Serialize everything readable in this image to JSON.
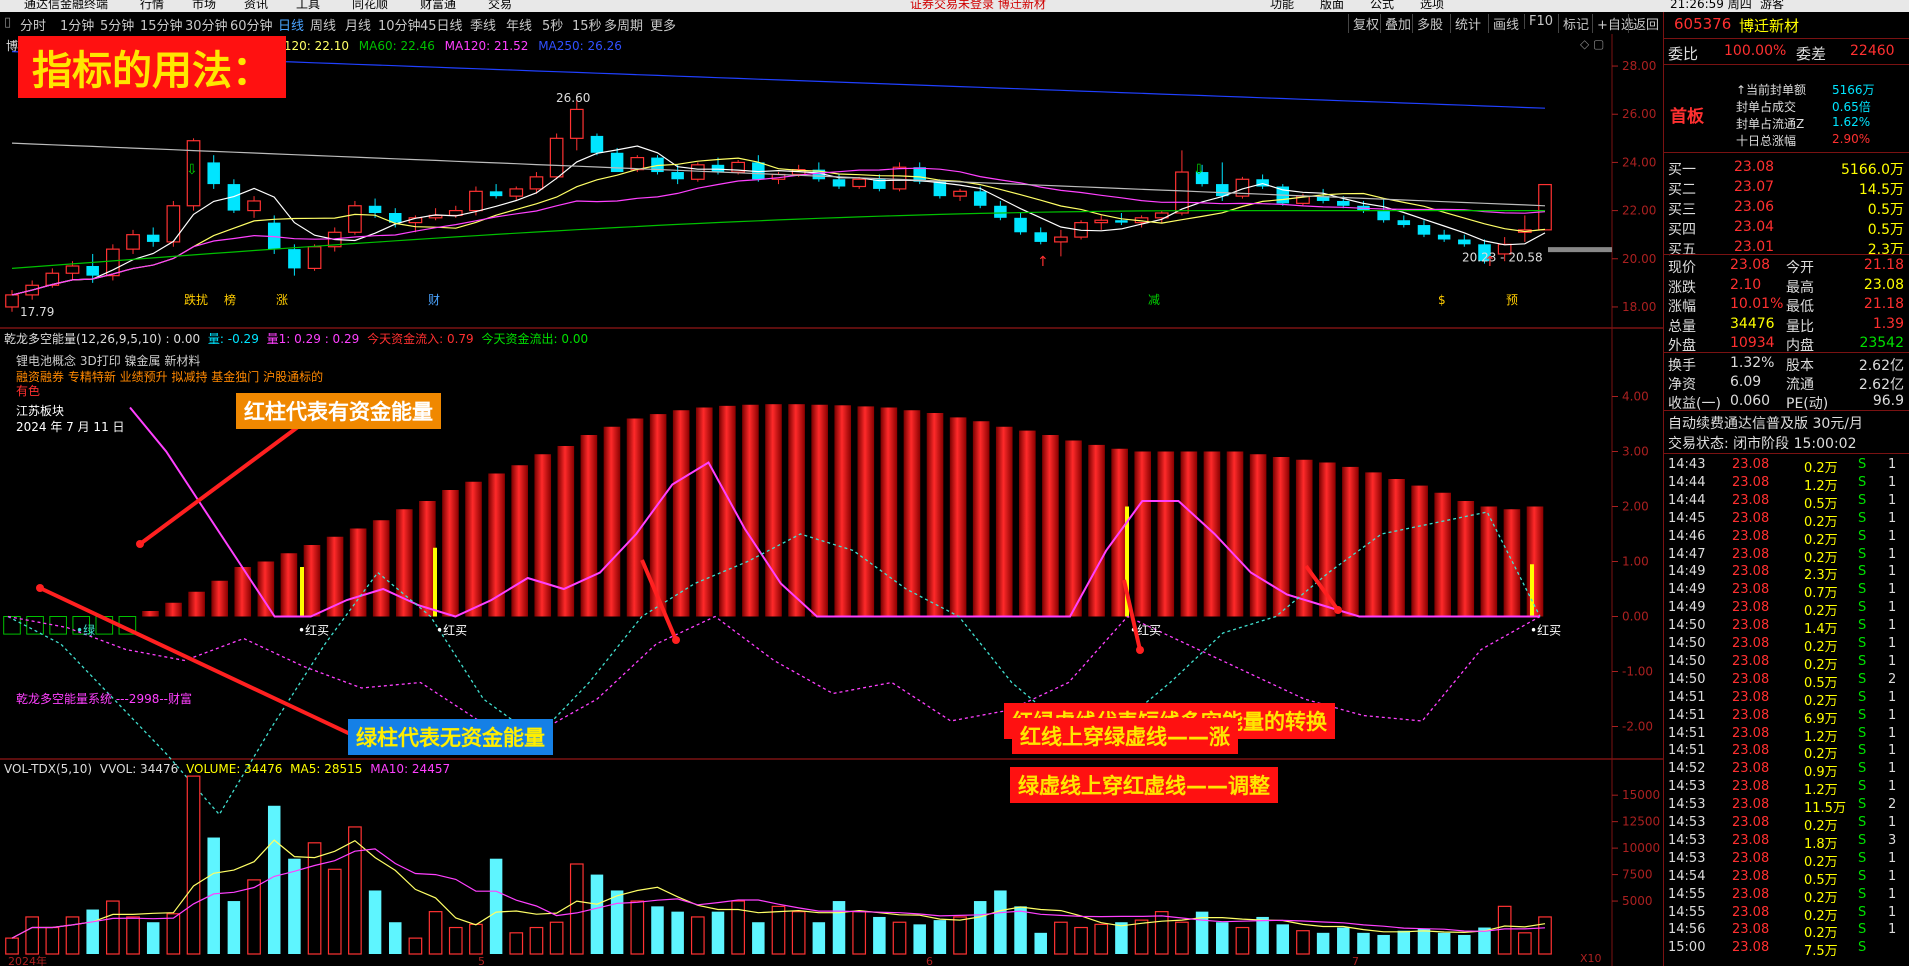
{
  "top_menu": {
    "items": [
      "通达信金融终端",
      "行情",
      "市场",
      "资讯",
      "工具",
      "发现",
      "同花顺",
      "财富通",
      "交易"
    ],
    "notice": "证券交易未登录  博迁新材",
    "right_items": [
      "功能",
      "版面",
      "公式",
      "选项"
    ],
    "clock": "21:26:59 周四",
    "right_label": "游客"
  },
  "period_tabs": [
    "分时",
    "1分钟",
    "5分钟",
    "15分钟",
    "30分钟",
    "60分钟",
    "日线",
    "周线",
    "月线",
    "10分钟",
    "45日线",
    "季线",
    "年线",
    "5秒",
    "15秒",
    "多周期",
    "更多"
  ],
  "active_period": "日线",
  "toolbar": [
    "复权",
    "叠加",
    "多股",
    "统计",
    "画线",
    "F10",
    "标记",
    "+自选",
    "返回"
  ],
  "main_chart": {
    "legend": {
      "name": "博迁",
      "ma20": "120: 22.10",
      "ma60": "MA60: 22.46",
      "ma120": "MA120: 21.52",
      "ma250": "MA250: 26.26"
    },
    "y_ticks": [
      "28.00",
      "26.00",
      "24.00",
      "22.00",
      "20.00",
      "18.00"
    ],
    "high_label": "26.60",
    "low_label": "17.79",
    "range_label": "20.23 - 20.58",
    "event_tags": [
      "跌扰",
      "榜",
      "涨",
      "财",
      "减",
      "$",
      "预"
    ],
    "colors": {
      "up": "#ff3232",
      "down": "#00e5ff",
      "ma_white": "#ffffff",
      "ma_yellow": "#ffff66",
      "ma_pink": "#ff40ff",
      "ma_green": "#00c000",
      "ma_blue": "#2040ff"
    }
  },
  "indicator": {
    "title": "乾龙多空能量(12,26,9,5,10) : 0.00",
    "liang": "量: -0.29",
    "liang1": "量1: 0.29 : 0.29",
    "inflow": "今天资金流入: 0.79",
    "outflow": "今天资金流出: 0.00",
    "info_lines": [
      "锂电池概念 3D打印 镍金属 新材料",
      "融资融券 专精特新 业绩预升 拟减持 基金独门 沪股通标的",
      "有色",
      "江苏板块"
    ],
    "date": "2024 年 7 月 11 日",
    "y_ticks": [
      "4.00",
      "3.00",
      "2.00",
      "1.00",
      "0.00",
      "-1.00",
      "-2.00"
    ],
    "signals": [
      "绿",
      "红买",
      "红买",
      "红买",
      "红买"
    ],
    "system_label": "乾龙多空能量系统 ---2998--财富"
  },
  "volume": {
    "title": "VOL-TDX(5,10)",
    "vvol": "VVOL: 34476",
    "volume": "VOLUME: 34476",
    "ma5": "MA5: 28515",
    "ma10": "MA10: 24457",
    "y_ticks": [
      "15000",
      "12500",
      "10000",
      "7500",
      "5000"
    ],
    "unit": "X10",
    "x_labels": [
      "2024年",
      "5",
      "6",
      "7"
    ]
  },
  "annotations": {
    "title": "指标的用法：",
    "red_bar": "红柱代表有资金能量",
    "green_bar": "绿柱代表无资金能量",
    "dashed": "红绿虚线代表短线多空能量的转换",
    "rise": "红线上穿绿虚线——涨",
    "adjust": "绿虚线上穿红虚线——调整"
  },
  "quote_panel": {
    "code": "605376",
    "name": "博迁新材",
    "weibi_label": "委比",
    "weibi": "100.00%",
    "weicha_label": "委差",
    "weicha": "22460",
    "board": "首板",
    "seal_info": [
      {
        "label": "↑当前封单额",
        "value": "5166万"
      },
      {
        "label": "封单占成交",
        "value": "0.65倍"
      },
      {
        "label": "封单占流通Z",
        "value": "1.62%"
      },
      {
        "label": "十日总涨幅",
        "value": "2.90%"
      }
    ],
    "bids": [
      {
        "label": "买一",
        "price": "23.08",
        "vol": "5166.0万"
      },
      {
        "label": "买二",
        "price": "23.07",
        "vol": "14.5万"
      },
      {
        "label": "买三",
        "price": "23.06",
        "vol": "0.5万"
      },
      {
        "label": "买四",
        "price": "23.04",
        "vol": "0.5万"
      },
      {
        "label": "买五",
        "price": "23.01",
        "vol": "2.3万"
      }
    ],
    "stats": [
      {
        "l1": "现价",
        "v1": "23.08",
        "l2": "今开",
        "v2": "21.18"
      },
      {
        "l1": "涨跌",
        "v1": "2.10",
        "l2": "最高",
        "v2": "23.08"
      },
      {
        "l1": "涨幅",
        "v1": "10.01%",
        "l2": "最低",
        "v2": "21.18"
      },
      {
        "l1": "总量",
        "v1": "34476",
        "l2": "量比",
        "v2": "1.39"
      },
      {
        "l1": "外盘",
        "v1": "10934",
        "l2": "内盘",
        "v2": "23542"
      }
    ],
    "stats2": [
      {
        "l1": "换手",
        "v1": "1.32%",
        "l2": "股本",
        "v2": "2.62亿"
      },
      {
        "l1": "净资",
        "v1": "6.09",
        "l2": "流通",
        "v2": "2.62亿"
      },
      {
        "l1": "收益(一)",
        "v1": "0.060",
        "l2": "PE(动)",
        "v2": "96.9"
      }
    ],
    "promo": "自动续费通达信普及版  30元/月",
    "status": "交易状态: 闭市阶段 15:00:02",
    "ticks": [
      {
        "t": "14:43",
        "p": "23.08",
        "v": "0.2万",
        "s": "S",
        "n": "1"
      },
      {
        "t": "14:44",
        "p": "23.08",
        "v": "1.2万",
        "s": "S",
        "n": "1"
      },
      {
        "t": "14:44",
        "p": "23.08",
        "v": "0.5万",
        "s": "S",
        "n": "1"
      },
      {
        "t": "14:45",
        "p": "23.08",
        "v": "0.2万",
        "s": "S",
        "n": "1"
      },
      {
        "t": "14:46",
        "p": "23.08",
        "v": "0.2万",
        "s": "S",
        "n": "1"
      },
      {
        "t": "14:47",
        "p": "23.08",
        "v": "0.2万",
        "s": "S",
        "n": "1"
      },
      {
        "t": "14:49",
        "p": "23.08",
        "v": "2.3万",
        "s": "S",
        "n": "1"
      },
      {
        "t": "14:49",
        "p": "23.08",
        "v": "0.7万",
        "s": "S",
        "n": "1"
      },
      {
        "t": "14:49",
        "p": "23.08",
        "v": "0.2万",
        "s": "S",
        "n": "1"
      },
      {
        "t": "14:50",
        "p": "23.08",
        "v": "1.4万",
        "s": "S",
        "n": "1"
      },
      {
        "t": "14:50",
        "p": "23.08",
        "v": "0.2万",
        "s": "S",
        "n": "1"
      },
      {
        "t": "14:50",
        "p": "23.08",
        "v": "0.2万",
        "s": "S",
        "n": "1"
      },
      {
        "t": "14:50",
        "p": "23.08",
        "v": "0.5万",
        "s": "S",
        "n": "2"
      },
      {
        "t": "14:51",
        "p": "23.08",
        "v": "0.2万",
        "s": "S",
        "n": "1"
      },
      {
        "t": "14:51",
        "p": "23.08",
        "v": "6.9万",
        "s": "S",
        "n": "1"
      },
      {
        "t": "14:51",
        "p": "23.08",
        "v": "1.2万",
        "s": "S",
        "n": "1"
      },
      {
        "t": "14:51",
        "p": "23.08",
        "v": "0.2万",
        "s": "S",
        "n": "1"
      },
      {
        "t": "14:52",
        "p": "23.08",
        "v": "0.9万",
        "s": "S",
        "n": "1"
      },
      {
        "t": "14:53",
        "p": "23.08",
        "v": "1.2万",
        "s": "S",
        "n": "1"
      },
      {
        "t": "14:53",
        "p": "23.08",
        "v": "11.5万",
        "s": "S",
        "n": "2"
      },
      {
        "t": "14:53",
        "p": "23.08",
        "v": "0.2万",
        "s": "S",
        "n": "1"
      },
      {
        "t": "14:53",
        "p": "23.08",
        "v": "1.8万",
        "s": "S",
        "n": "3"
      },
      {
        "t": "14:53",
        "p": "23.08",
        "v": "0.2万",
        "s": "S",
        "n": "1"
      },
      {
        "t": "14:54",
        "p": "23.08",
        "v": "0.5万",
        "s": "S",
        "n": "1"
      },
      {
        "t": "14:55",
        "p": "23.08",
        "v": "0.2万",
        "s": "S",
        "n": "1"
      },
      {
        "t": "14:55",
        "p": "23.08",
        "v": "0.2万",
        "s": "S",
        "n": "1"
      },
      {
        "t": "14:56",
        "p": "23.08",
        "v": "0.2万",
        "s": "S",
        "n": "1"
      },
      {
        "t": "15:00",
        "p": "23.08",
        "v": "7.5万",
        "s": "S",
        "n": ""
      }
    ]
  },
  "chart_data": [
    {
      "type": "candlestick",
      "title": "博迁新材 日线",
      "ylim": [
        17.5,
        28.5
      ],
      "moving_averages": {
        "MA20": 22.1,
        "MA60": 22.46,
        "MA120": 21.52,
        "MA250": 26.26
      },
      "ohlc": [
        [
          18.0,
          18.7,
          17.8,
          18.5
        ],
        [
          18.5,
          19.1,
          18.3,
          18.9
        ],
        [
          18.9,
          19.6,
          18.8,
          19.4
        ],
        [
          19.4,
          19.9,
          19.1,
          19.7
        ],
        [
          19.7,
          20.2,
          19.0,
          19.3
        ],
        [
          19.3,
          20.6,
          19.1,
          20.4
        ],
        [
          20.4,
          21.2,
          20.2,
          21.0
        ],
        [
          21.0,
          21.3,
          20.5,
          20.7
        ],
        [
          20.7,
          22.4,
          20.5,
          22.2
        ],
        [
          22.2,
          25.0,
          22.0,
          24.9
        ],
        [
          24.0,
          24.3,
          22.9,
          23.1
        ],
        [
          23.1,
          23.3,
          21.9,
          22.0
        ],
        [
          22.0,
          22.6,
          21.7,
          22.4
        ],
        [
          21.5,
          21.8,
          20.2,
          20.4
        ],
        [
          20.4,
          20.6,
          19.3,
          19.6
        ],
        [
          19.6,
          20.6,
          19.5,
          20.5
        ],
        [
          20.5,
          21.3,
          20.3,
          21.1
        ],
        [
          21.1,
          22.4,
          21.0,
          22.2
        ],
        [
          22.2,
          22.5,
          21.7,
          21.9
        ],
        [
          21.9,
          22.1,
          21.3,
          21.5
        ],
        [
          21.5,
          21.8,
          21.1,
          21.7
        ],
        [
          21.7,
          22.1,
          21.6,
          21.8
        ],
        [
          21.8,
          22.2,
          21.7,
          22.0
        ],
        [
          22.0,
          23.0,
          21.8,
          22.8
        ],
        [
          22.8,
          23.1,
          22.5,
          22.6
        ],
        [
          22.6,
          23.0,
          22.4,
          22.9
        ],
        [
          22.9,
          23.6,
          22.7,
          23.4
        ],
        [
          23.4,
          25.2,
          23.3,
          25.0
        ],
        [
          25.0,
          26.6,
          24.5,
          26.2
        ],
        [
          25.1,
          25.2,
          24.3,
          24.4
        ],
        [
          24.4,
          24.6,
          23.6,
          23.6
        ],
        [
          23.7,
          24.3,
          23.6,
          24.2
        ],
        [
          24.2,
          24.3,
          23.5,
          23.6
        ],
        [
          23.6,
          23.9,
          23.1,
          23.3
        ],
        [
          23.3,
          24.0,
          23.2,
          23.9
        ],
        [
          23.9,
          24.2,
          23.5,
          23.6
        ],
        [
          23.6,
          24.1,
          23.5,
          24.0
        ],
        [
          24.0,
          24.3,
          23.2,
          23.3
        ],
        [
          23.3,
          23.6,
          23.1,
          23.5
        ],
        [
          23.5,
          23.9,
          23.4,
          23.7
        ],
        [
          23.7,
          24.0,
          23.2,
          23.3
        ],
        [
          23.3,
          23.5,
          22.9,
          23.0
        ],
        [
          23.0,
          23.4,
          22.9,
          23.3
        ],
        [
          23.3,
          23.5,
          22.8,
          22.9
        ],
        [
          22.9,
          24.0,
          22.8,
          23.8
        ],
        [
          23.8,
          24.0,
          23.1,
          23.2
        ],
        [
          23.2,
          23.3,
          22.5,
          22.6
        ],
        [
          22.6,
          22.9,
          22.4,
          22.8
        ],
        [
          22.8,
          23.0,
          22.1,
          22.2
        ],
        [
          22.2,
          22.4,
          21.6,
          21.7
        ],
        [
          21.7,
          21.9,
          21.0,
          21.1
        ],
        [
          21.1,
          21.3,
          20.6,
          20.7
        ],
        [
          20.7,
          21.2,
          20.1,
          20.9
        ],
        [
          20.9,
          21.6,
          20.8,
          21.5
        ],
        [
          21.5,
          21.8,
          21.2,
          21.6
        ],
        [
          21.6,
          21.9,
          21.4,
          21.5
        ],
        [
          21.5,
          21.8,
          21.3,
          21.7
        ],
        [
          21.7,
          22.0,
          21.5,
          21.9
        ],
        [
          21.9,
          24.5,
          21.8,
          23.6
        ],
        [
          23.6,
          23.9,
          23.0,
          23.1
        ],
        [
          23.1,
          24.0,
          22.4,
          22.6
        ],
        [
          22.6,
          23.4,
          22.5,
          23.3
        ],
        [
          23.3,
          23.5,
          22.9,
          23.0
        ],
        [
          23.0,
          23.1,
          22.2,
          22.3
        ],
        [
          22.3,
          22.7,
          22.2,
          22.6
        ],
        [
          22.6,
          22.9,
          22.3,
          22.4
        ],
        [
          22.4,
          22.6,
          22.1,
          22.2
        ],
        [
          22.2,
          22.4,
          21.9,
          22.0
        ],
        [
          22.0,
          22.5,
          21.5,
          21.6
        ],
        [
          21.6,
          21.8,
          21.3,
          21.4
        ],
        [
          21.4,
          21.6,
          20.9,
          21.0
        ],
        [
          21.0,
          21.2,
          20.7,
          20.8
        ],
        [
          20.8,
          21.0,
          20.5,
          20.6
        ],
        [
          20.6,
          20.8,
          19.8,
          19.9
        ],
        [
          20.2,
          20.9,
          19.9,
          20.6
        ],
        [
          21.1,
          21.8,
          20.7,
          21.2
        ],
        [
          21.2,
          23.08,
          21.18,
          23.08
        ]
      ]
    },
    {
      "type": "bar+line",
      "title": "乾龙多空能量(12,26,9,5,10)",
      "ylim": [
        -2.5,
        4.5
      ],
      "bars": [
        -0.32,
        -0.32,
        -0.32,
        -0.32,
        -0.32,
        -0.32,
        0.1,
        0.25,
        0.45,
        0.65,
        0.9,
        1.0,
        1.15,
        1.3,
        1.45,
        1.6,
        1.75,
        1.95,
        2.1,
        2.3,
        2.45,
        2.6,
        2.75,
        2.95,
        3.1,
        3.3,
        3.45,
        3.6,
        3.68,
        3.75,
        3.8,
        3.83,
        3.85,
        3.86,
        3.86,
        3.85,
        3.84,
        3.82,
        3.8,
        3.75,
        3.7,
        3.62,
        3.55,
        3.45,
        3.38,
        3.3,
        3.2,
        3.12,
        3.05,
        3.0,
        3.0,
        3.0,
        3.0,
        3.0,
        2.95,
        2.9,
        2.85,
        2.8,
        2.72,
        2.62,
        2.5,
        2.38,
        2.25,
        2.1,
        2.0,
        1.95,
        2.0
      ],
      "pink_line": [
        3.8,
        3.0,
        2.0,
        1.0,
        0.0,
        0.0,
        0.3,
        0.5,
        0.2,
        0.0,
        0.3,
        0.7,
        0.5,
        0.8,
        1.5,
        2.4,
        2.8,
        1.6,
        0.6,
        0.0,
        0.0,
        0.0,
        0.0,
        0.0,
        0.0,
        0.0,
        0.0,
        1.2,
        2.1,
        2.1,
        1.5,
        0.8,
        0.4,
        0.2,
        0.0,
        0.0,
        0.0,
        0.0,
        0.0,
        0.0
      ],
      "green_dashed": [
        0.0,
        -0.5,
        -1.5,
        -2.5,
        -3.6,
        -2.0,
        -0.5,
        0.8,
        0.0,
        -1.5,
        -2.2,
        -1.2,
        0.0,
        0.6,
        1.0,
        1.5,
        1.2,
        0.5,
        0.0,
        -1.2,
        -2.0,
        -2.0,
        -1.2,
        -0.3,
        0.0,
        0.8,
        1.5,
        1.7,
        1.9,
        0.0
      ],
      "red_dashed": [
        0.0,
        -0.2,
        -0.6,
        -0.8,
        -0.4,
        -0.9,
        -1.3,
        -1.2,
        -1.9,
        -2.1,
        -1.5,
        -0.5,
        0.0,
        -0.8,
        -1.4,
        -1.2,
        -1.9,
        -1.7,
        -1.2,
        0.0,
        -0.5,
        -1.0,
        -1.5,
        -1.8,
        -1.9,
        -0.6,
        0.0
      ],
      "series": [
        {
          "name": "量",
          "value": -0.29
        },
        {
          "name": "量1",
          "value": 0.29
        },
        {
          "name": "今天资金流入",
          "value": 0.79
        },
        {
          "name": "今天资金流出",
          "value": 0.0
        }
      ]
    },
    {
      "type": "bar+line",
      "title": "VOL-TDX(5,10)",
      "ylim": [
        0,
        17000
      ],
      "unit": "X10",
      "volumes": [
        1500,
        3500,
        2500,
        3500,
        4200,
        5000,
        3500,
        3000,
        3800,
        16800,
        11000,
        5000,
        7000,
        14000,
        9000,
        10500,
        8000,
        12000,
        6000,
        3000,
        1500,
        4000,
        2500,
        2800,
        9000,
        2000,
        2500,
        3000,
        8500,
        7500,
        6000,
        5000,
        4500,
        4000,
        3500,
        4000,
        5000,
        3000,
        4500,
        4000,
        3000,
        5000,
        4000,
        3500,
        3000,
        2800,
        3200,
        3500,
        5000,
        6000,
        4500,
        2000,
        3000,
        2500,
        2800,
        3000,
        3200,
        4000,
        3000,
        4000,
        3000,
        2500,
        3500,
        2800,
        2200,
        2000,
        2500,
        2000,
        1800,
        2200,
        2400,
        2000,
        1800,
        2500,
        4500,
        2000,
        3500
      ],
      "ma5": 28515,
      "ma10": 24457
    }
  ]
}
